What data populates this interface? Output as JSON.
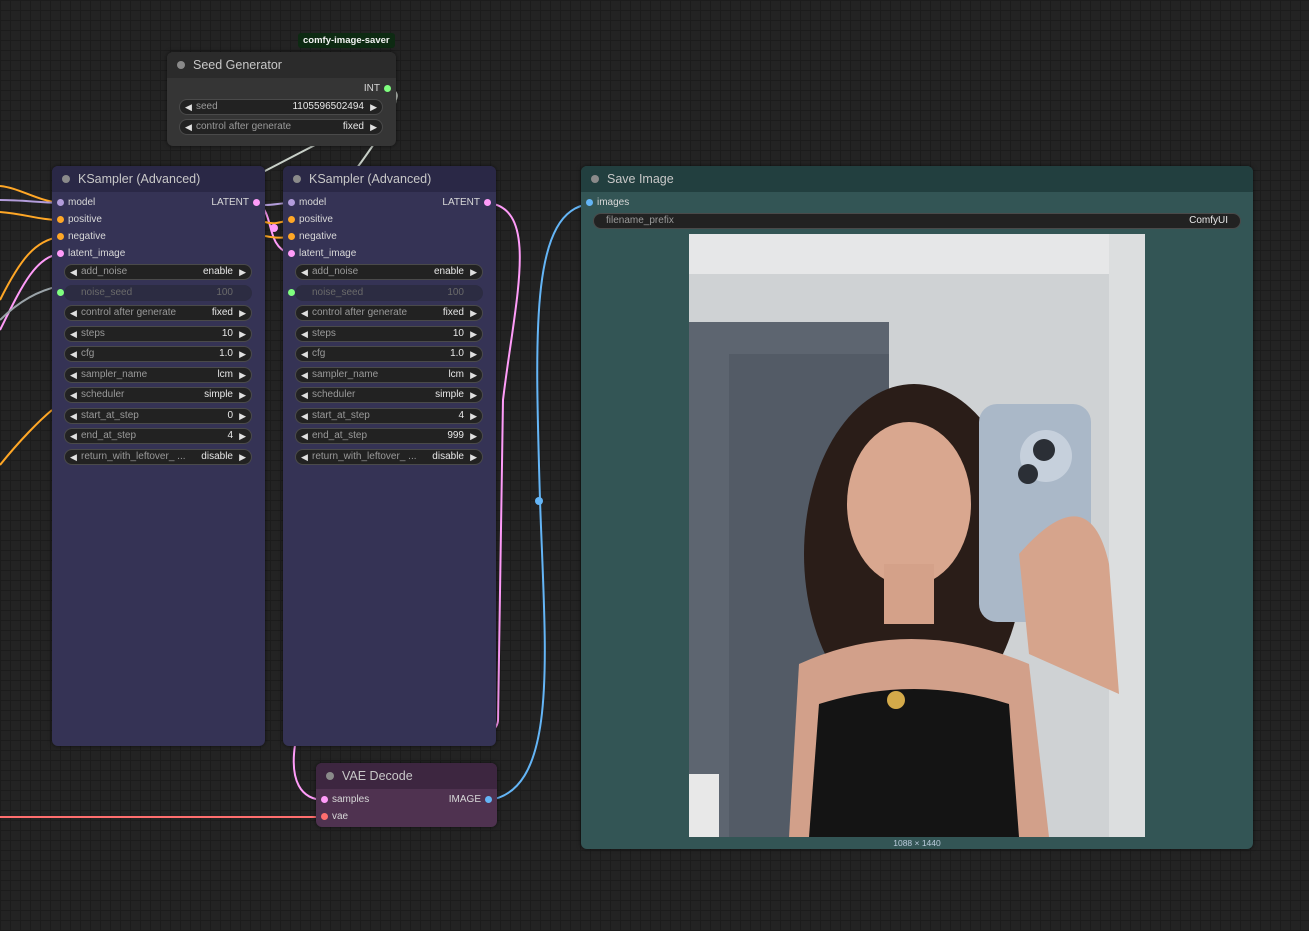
{
  "badge": "comfy-image-saver",
  "seed_generator": {
    "title": "Seed Generator",
    "output": "INT",
    "widgets": [
      {
        "label": "seed",
        "value": "1105596502494"
      },
      {
        "label": "control after generate",
        "value": "fixed"
      }
    ]
  },
  "ksampler1": {
    "title": "KSampler (Advanced)",
    "inputs": [
      "model",
      "positive",
      "negative",
      "latent_image"
    ],
    "output": "LATENT",
    "noise_seed": {
      "label": "noise_seed",
      "value": "100"
    },
    "widgets": [
      {
        "label": "add_noise",
        "value": "enable"
      },
      {
        "label": "control after generate",
        "value": "fixed"
      },
      {
        "label": "steps",
        "value": "10"
      },
      {
        "label": "cfg",
        "value": "1.0"
      },
      {
        "label": "sampler_name",
        "value": "lcm"
      },
      {
        "label": "scheduler",
        "value": "simple"
      },
      {
        "label": "start_at_step",
        "value": "0"
      },
      {
        "label": "end_at_step",
        "value": "4"
      },
      {
        "label": "return_with_leftover_ ...",
        "value": "disable"
      }
    ]
  },
  "ksampler2": {
    "title": "KSampler (Advanced)",
    "inputs": [
      "model",
      "positive",
      "negative",
      "latent_image"
    ],
    "output": "LATENT",
    "noise_seed": {
      "label": "noise_seed",
      "value": "100"
    },
    "widgets": [
      {
        "label": "add_noise",
        "value": "enable"
      },
      {
        "label": "control after generate",
        "value": "fixed"
      },
      {
        "label": "steps",
        "value": "10"
      },
      {
        "label": "cfg",
        "value": "1.0"
      },
      {
        "label": "sampler_name",
        "value": "lcm"
      },
      {
        "label": "scheduler",
        "value": "simple"
      },
      {
        "label": "start_at_step",
        "value": "4"
      },
      {
        "label": "end_at_step",
        "value": "999"
      },
      {
        "label": "return_with_leftover_ ...",
        "value": "disable"
      }
    ]
  },
  "vae_decode": {
    "title": "VAE Decode",
    "inputs": [
      "samples",
      "vae"
    ],
    "output": "IMAGE"
  },
  "save_image": {
    "title": "Save Image",
    "input": "images",
    "filename_prefix": {
      "label": "filename_prefix",
      "value": "ComfyUI"
    },
    "image_size": "1088 × 1440"
  },
  "colors": {
    "model": "#b39ddb",
    "positive": "#ffa726",
    "negative": "#ffa726",
    "latent": "#ff9cf9",
    "int": "#7fff7f",
    "image": "#64b5f6",
    "vae": "#ff6e6e",
    "ksampler_body": "#353355",
    "ksampler_title": "#2a2846",
    "vae_body": "#4f3250",
    "vae_title": "#3d2640",
    "save_body": "#335555",
    "save_title": "#223f3f"
  }
}
